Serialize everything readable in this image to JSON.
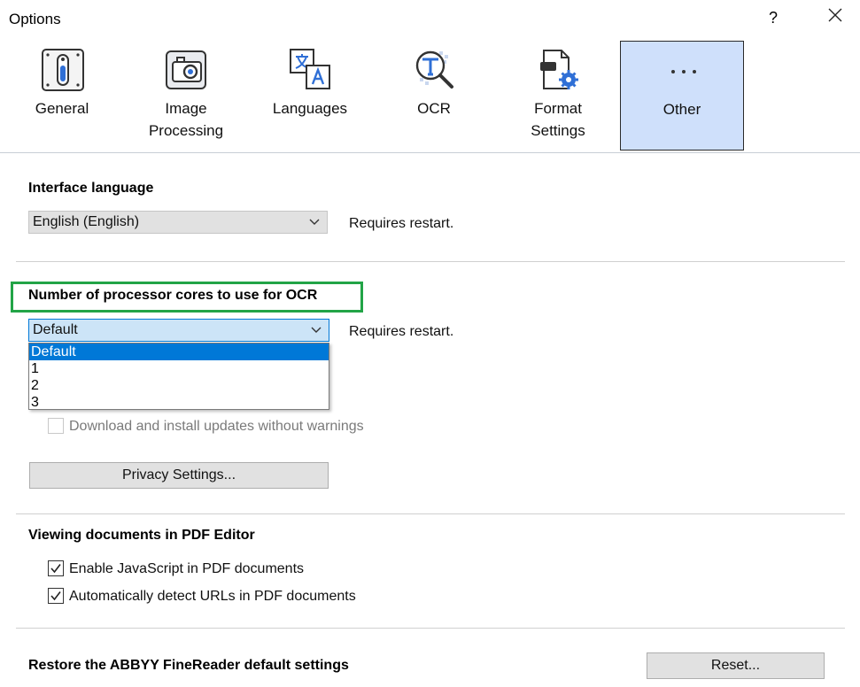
{
  "window": {
    "title": "Options",
    "help_label": "?"
  },
  "toolbar": {
    "items": [
      {
        "label_line1": "General",
        "label_line2": ""
      },
      {
        "label_line1": "Image",
        "label_line2": "Processing"
      },
      {
        "label_line1": "Languages",
        "label_line2": ""
      },
      {
        "label_line1": "OCR",
        "label_line2": ""
      },
      {
        "label_line1": "Format",
        "label_line2": "Settings"
      },
      {
        "label_line1": "Other",
        "label_line2": "",
        "selected": true
      }
    ]
  },
  "interface_language": {
    "heading": "Interface language",
    "selected": "English (English)",
    "note": "Requires restart."
  },
  "processor_cores": {
    "heading": "Number of processor cores to use for OCR",
    "selected": "Default",
    "note": "Requires restart.",
    "options": [
      "Default",
      "1",
      "2",
      "3"
    ]
  },
  "updates": {
    "auto_install_label": "Download and install updates without warnings",
    "auto_install_checked": false,
    "auto_install_enabled": false,
    "privacy_button": "Privacy Settings..."
  },
  "pdf_editor": {
    "heading": "Viewing documents in PDF Editor",
    "javascript_label": "Enable JavaScript in PDF documents",
    "javascript_checked": true,
    "urls_label": "Automatically detect URLs in PDF documents",
    "urls_checked": true
  },
  "restore": {
    "heading": "Restore the ABBYY FineReader default settings",
    "reset_button": "Reset..."
  },
  "colors": {
    "accent": "#0078d7",
    "selected_tab_bg": "#cfe0fb",
    "highlight_box": "#22a447"
  }
}
